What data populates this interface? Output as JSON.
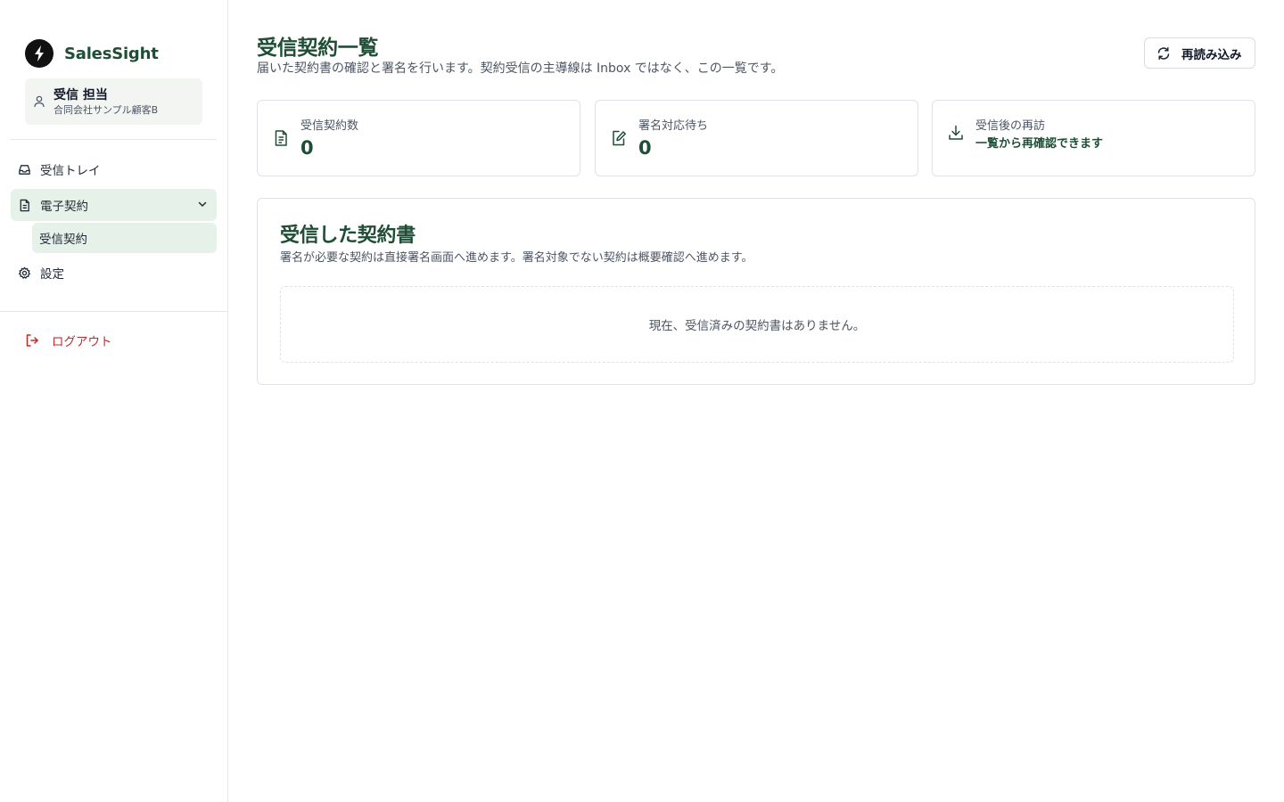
{
  "brand": {
    "name": "SalesSight",
    "icon": "brand-logo-icon"
  },
  "user": {
    "name": "受信 担当",
    "org": "合同会社サンプル顧客B",
    "icon": "user-icon"
  },
  "nav": {
    "items": [
      {
        "label": "受信トレイ",
        "icon": "inbox-icon"
      },
      {
        "label": "電子契約",
        "icon": "document-icon",
        "expanded": true
      },
      {
        "label": "設定",
        "icon": "gear-icon"
      }
    ],
    "sub_items": [
      {
        "label": "受信契約"
      }
    ],
    "logout": {
      "label": "ログアウト",
      "icon": "logout-icon"
    }
  },
  "header": {
    "title": "受信契約一覧",
    "subtitle": "届いた契約書の確認と署名を行います。契約受信の主導線は Inbox ではなく、この一覧です。",
    "reload_label": "再読み込み"
  },
  "stats": [
    {
      "label": "受信契約数",
      "value": "0",
      "icon": "file-text-icon"
    },
    {
      "label": "署名対応待ち",
      "value": "0",
      "icon": "edit-icon"
    },
    {
      "label": "受信後の再訪",
      "sub": "一覧から再確認できます",
      "icon": "download-icon"
    }
  ],
  "panel": {
    "title": "受信した契約書",
    "subtitle": "署名が必要な契約は直接署名画面へ進めます。署名対象でない契約は概要確認へ進めます。",
    "empty": "現在、受信済みの契約書はありません。"
  },
  "colors": {
    "accent": "#1f4d36",
    "active_bg": "#e6f2e9",
    "danger": "#c62828"
  }
}
